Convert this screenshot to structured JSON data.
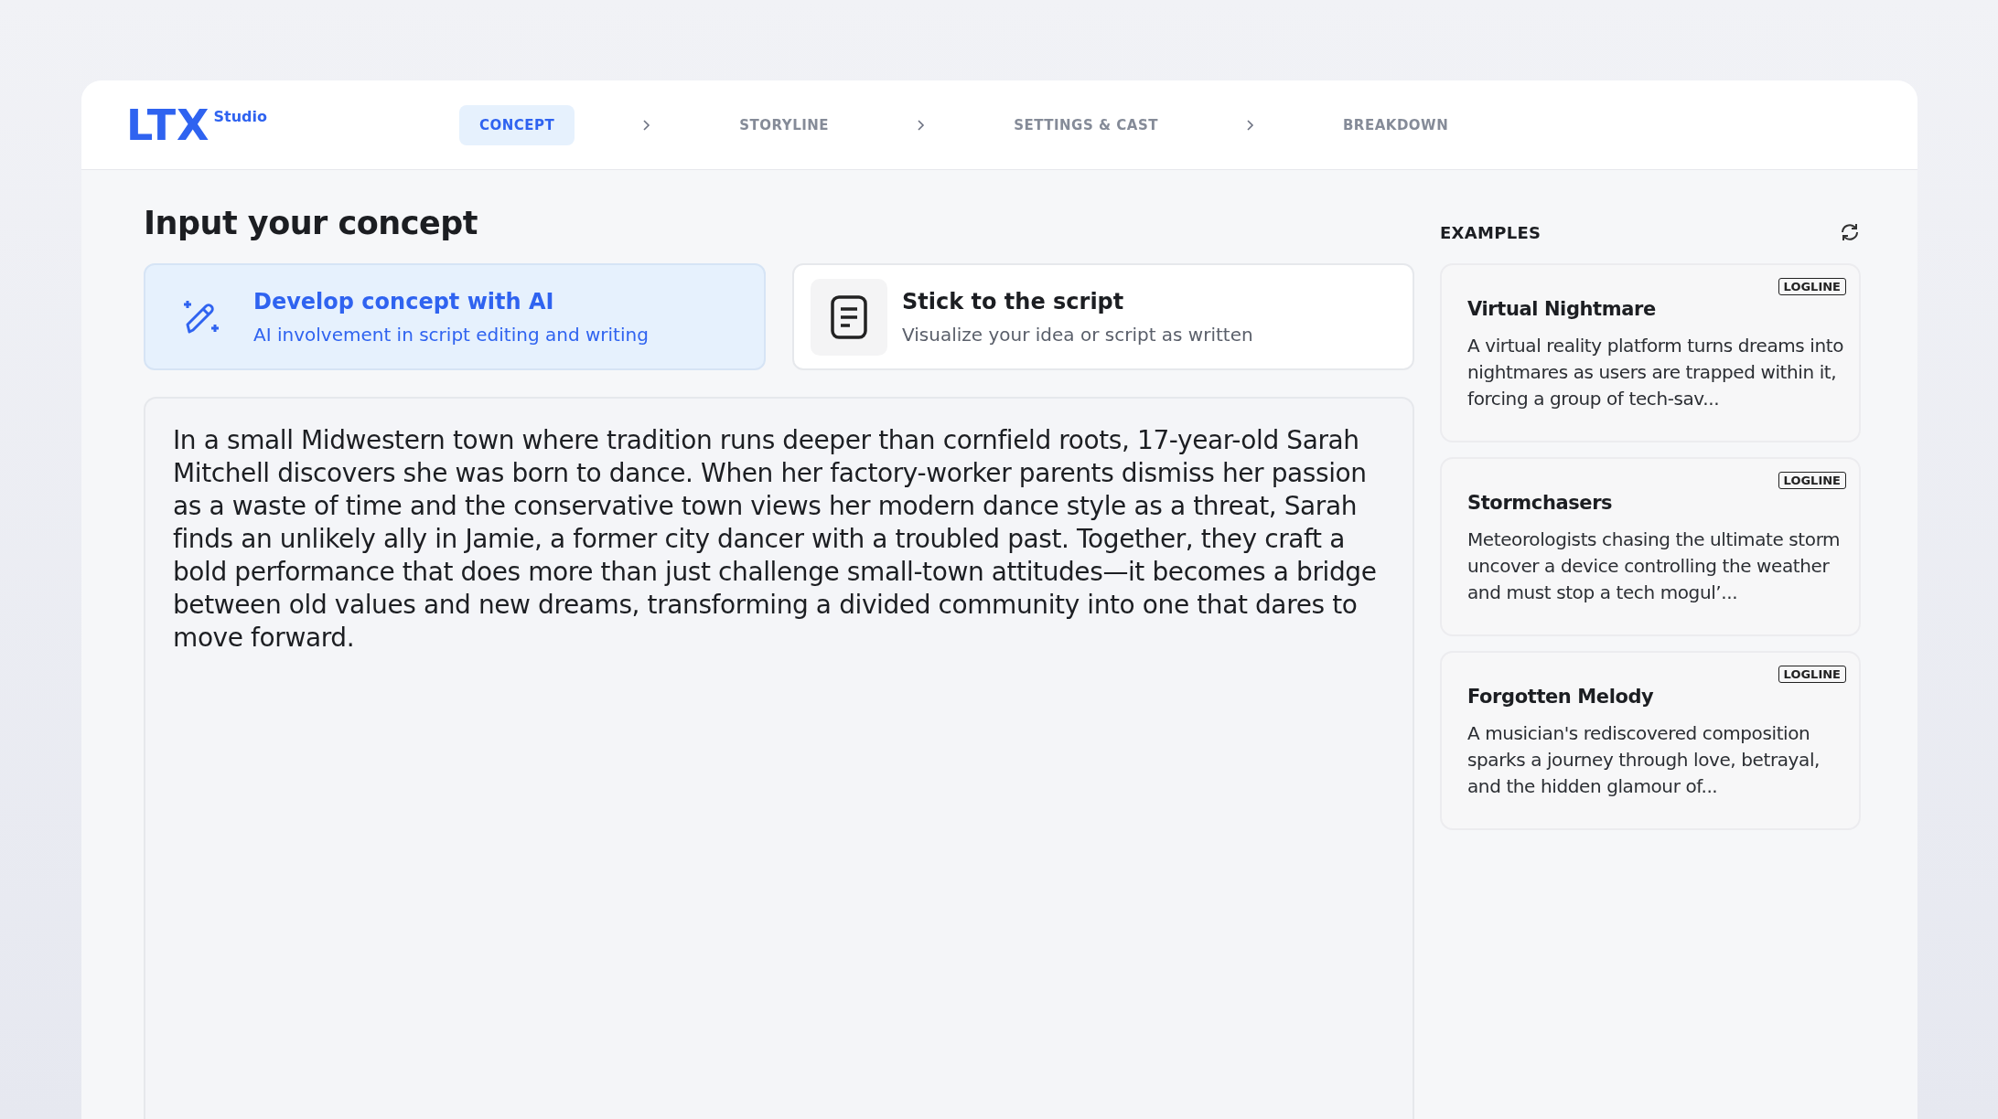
{
  "logo": {
    "mark": "LTX",
    "sub": "Studio"
  },
  "steps": [
    {
      "label": "CONCEPT",
      "selected": true
    },
    {
      "label": "STORYLINE",
      "selected": false
    },
    {
      "label": "SETTINGS & CAST",
      "selected": false
    },
    {
      "label": "BREAKDOWN",
      "selected": false
    }
  ],
  "page_title": "Input your concept",
  "modes": [
    {
      "kind": "ai",
      "title": "Develop concept with AI",
      "subtitle": "AI involvement in script editing and writing",
      "selected": true
    },
    {
      "kind": "script",
      "title": "Stick to the script",
      "subtitle": "Visualize your idea or script as written",
      "selected": false
    }
  ],
  "concept": {
    "value": "In a small Midwestern town where tradition runs deeper than cornfield roots, 17-year-old Sarah Mitchell discovers she was born to dance. When her factory-worker parents dismiss her passion as a waste of time and the conservative town views her modern dance style as a threat, Sarah finds an unlikely ally in Jamie, a former city dancer with a troubled past. Together, they craft a bold performance that does more than just challenge small-town attitudes—it becomes a bridge between old values and new dreams, transforming a divided community into one that dares to move forward."
  },
  "examples": {
    "heading": "EXAMPLES",
    "items": [
      {
        "tag": "LOGLINE",
        "title": "Virtual Nightmare",
        "text": "A virtual reality platform turns dreams into nightmares as users are trapped within it, forcing a group of tech-sav..."
      },
      {
        "tag": "LOGLINE",
        "title": "Stormchasers",
        "text": "Meteorologists chasing the ultimate storm uncover a device controlling the weather and must stop a tech mogul’..."
      },
      {
        "tag": "LOGLINE",
        "title": "Forgotten Melody",
        "text": "A musician's rediscovered composition sparks a journey through love, betrayal, and the hidden glamour of..."
      }
    ]
  }
}
